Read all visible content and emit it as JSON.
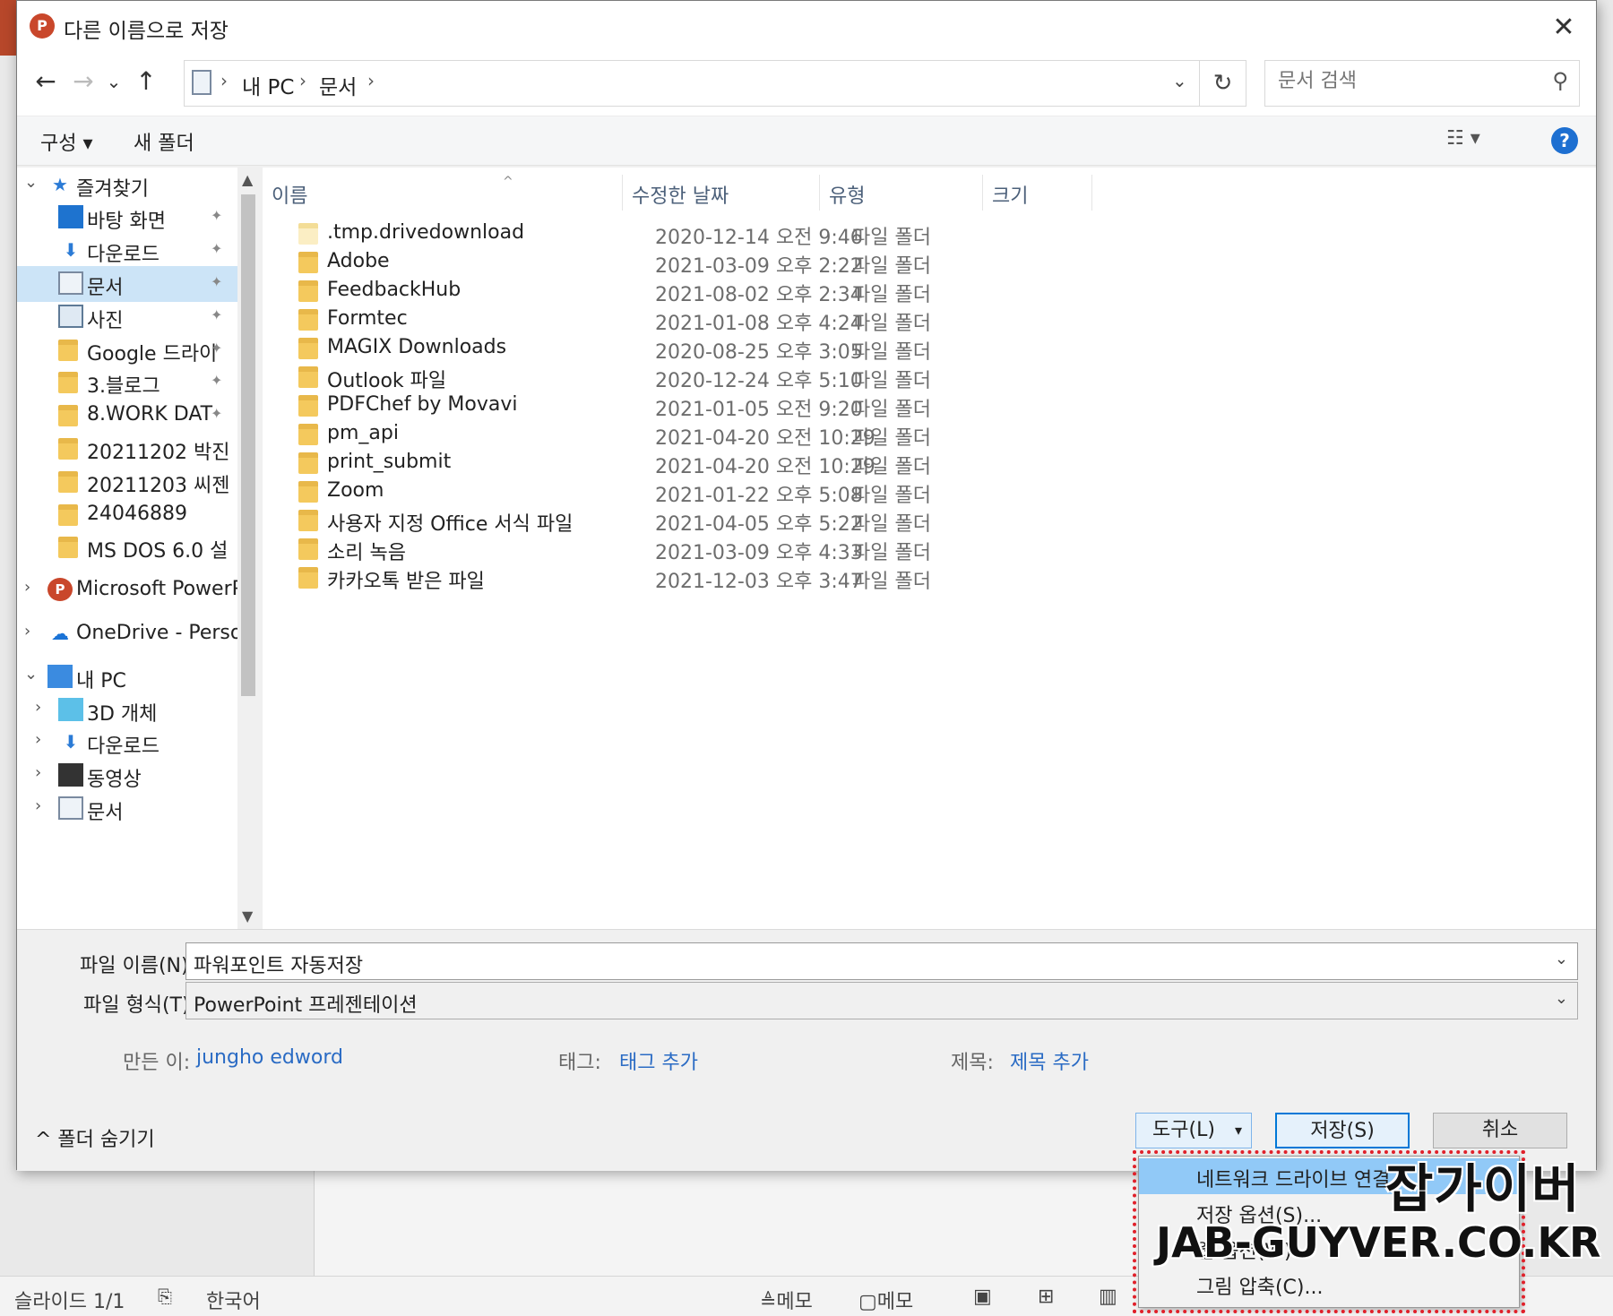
{
  "window": {
    "title": "다른 이름으로 저장",
    "app_icon_letter": "P",
    "close_glyph": "✕"
  },
  "nav": {
    "back_glyph": "←",
    "forward_glyph": "→",
    "recent_glyph": "⌄",
    "up_glyph": "↑",
    "breadcrumb": [
      "내 PC",
      "문서"
    ],
    "crumb_sep": "›",
    "dropdown_glyph": "⌄",
    "refresh_glyph": "↻",
    "search_placeholder": "문서 검색",
    "search_glyph": "⚲"
  },
  "toolbar": {
    "organize_label": "구성 ▾",
    "new_folder_label": "새 폴더",
    "view_glyph": "☷ ▾",
    "help_glyph": "?"
  },
  "navpane": {
    "items": [
      {
        "label": "즐겨찾기",
        "expander": "⌄",
        "icon": "star-icon",
        "pinned": false
      },
      {
        "label": "바탕 화면",
        "expander": "",
        "icon": "desktop-icon",
        "pinned": true
      },
      {
        "label": "다운로드",
        "expander": "",
        "icon": "download-icon",
        "pinned": true
      },
      {
        "label": "문서",
        "expander": "",
        "icon": "document-icon",
        "pinned": true
      },
      {
        "label": "사진",
        "expander": "",
        "icon": "picture-icon",
        "pinned": true
      },
      {
        "label": "Google 드라이",
        "expander": "",
        "icon": "folder-icon",
        "pinned": true
      },
      {
        "label": "3.블로그",
        "expander": "",
        "icon": "folder-icon",
        "pinned": true
      },
      {
        "label": "8.WORK DAT",
        "expander": "",
        "icon": "folder-icon",
        "pinned": true
      },
      {
        "label": "20211202 박진",
        "expander": "",
        "icon": "folder-icon",
        "pinned": false
      },
      {
        "label": "20211203 씨젠",
        "expander": "",
        "icon": "folder-icon",
        "pinned": false
      },
      {
        "label": "24046889",
        "expander": "",
        "icon": "folder-icon",
        "pinned": false
      },
      {
        "label": "MS DOS 6.0 설",
        "expander": "",
        "icon": "folder-icon",
        "pinned": false
      },
      {
        "label": "Microsoft PowerP",
        "expander": "›",
        "icon": "powerpoint-icon",
        "pinned": false
      },
      {
        "label": "OneDrive - Persor",
        "expander": "›",
        "icon": "onedrive-icon",
        "pinned": false
      },
      {
        "label": "내 PC",
        "expander": "⌄",
        "icon": "computer-icon",
        "pinned": false
      },
      {
        "label": "3D 개체",
        "expander": "›",
        "icon": "cube-icon",
        "pinned": false
      },
      {
        "label": "다운로드",
        "expander": "›",
        "icon": "download-icon",
        "pinned": false
      },
      {
        "label": "동영상",
        "expander": "›",
        "icon": "video-icon",
        "pinned": false
      },
      {
        "label": "문서",
        "expander": "›",
        "icon": "document-icon",
        "pinned": false
      }
    ],
    "pin_glyph": "📌",
    "scroll_up": "▲",
    "scroll_down": "▼"
  },
  "filelist": {
    "columns": [
      "이름",
      "수정한 날짜",
      "유형",
      "크기"
    ],
    "sort_glyph": "^",
    "rows": [
      {
        "name": ".tmp.drivedownload",
        "date": "2020-12-14 오전 9:46",
        "type": "파일 폴더"
      },
      {
        "name": "Adobe",
        "date": "2021-03-09 오후 2:22",
        "type": "파일 폴더"
      },
      {
        "name": "FeedbackHub",
        "date": "2021-08-02 오후 2:34",
        "type": "파일 폴더"
      },
      {
        "name": "Formtec",
        "date": "2021-01-08 오후 4:24",
        "type": "파일 폴더"
      },
      {
        "name": "MAGIX Downloads",
        "date": "2020-08-25 오후 3:05",
        "type": "파일 폴더"
      },
      {
        "name": "Outlook 파일",
        "date": "2020-12-24 오후 5:10",
        "type": "파일 폴더"
      },
      {
        "name": "PDFChef by Movavi",
        "date": "2021-01-05 오전 9:20",
        "type": "파일 폴더"
      },
      {
        "name": "pm_api",
        "date": "2021-04-20 오전 10:29",
        "type": "파일 폴더"
      },
      {
        "name": "print_submit",
        "date": "2021-04-20 오전 10:29",
        "type": "파일 폴더"
      },
      {
        "name": "Zoom",
        "date": "2021-01-22 오후 5:08",
        "type": "파일 폴더"
      },
      {
        "name": "사용자 지정 Office 서식 파일",
        "date": "2021-04-05 오후 5:22",
        "type": "파일 폴더"
      },
      {
        "name": "소리 녹음",
        "date": "2021-03-09 오후 4:33",
        "type": "파일 폴더"
      },
      {
        "name": "카카오톡 받은 파일",
        "date": "2021-12-03 오후 3:47",
        "type": "파일 폴더"
      }
    ]
  },
  "form": {
    "filename_label": "파일 이름(N):",
    "filename_value": "파워포인트 자동저장",
    "filetype_label": "파일 형식(T):",
    "filetype_value": "PowerPoint 프레젠테이션",
    "dd_glyph": "⌄",
    "author_label": "만든 이:",
    "author_value": "jungho edword",
    "tags_label": "태그:",
    "tags_value": "태그 추가",
    "title_label": "제목:",
    "title_value": "제목 추가",
    "hide_folders_label": "^  폴더 숨기기",
    "tools_label": "도구(L)",
    "tools_caret": "▾",
    "save_label": "저장(S)",
    "cancel_label": "취소"
  },
  "tools_menu": {
    "items": [
      "네트워크 드라이브 연결",
      "저장 옵션(S)...",
      "웹 옵션(W)...",
      "그림 압축(C)..."
    ]
  },
  "status": {
    "slide": "슬라이드 1/1",
    "lang": "한국어",
    "notes": "≜메모",
    "comments": "▢메모"
  },
  "watermark": {
    "korean": "잡가이버",
    "url": "JAB-GUYVER.CO.KR"
  }
}
